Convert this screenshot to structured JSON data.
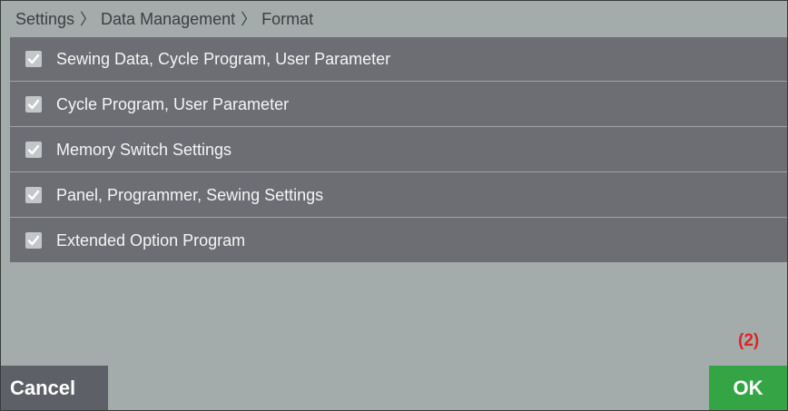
{
  "breadcrumb": {
    "items": [
      "Settings",
      "Data Management",
      "Format"
    ],
    "separator": "〉"
  },
  "format_options": [
    {
      "label": "Sewing Data, Cycle Program, User Parameter",
      "checked": true
    },
    {
      "label": "Cycle Program, User Parameter",
      "checked": true
    },
    {
      "label": "Memory Switch Settings",
      "checked": true
    },
    {
      "label": "Panel, Programmer, Sewing Settings",
      "checked": true
    },
    {
      "label": "Extended Option Program",
      "checked": true
    }
  ],
  "annotation": "(2)",
  "footer": {
    "cancel_label": "Cancel",
    "ok_label": "OK"
  },
  "colors": {
    "background": "#a4acab",
    "list_row": "#6c6e74",
    "cancel_button": "#5d6067",
    "ok_button": "#35a445",
    "annotation": "#e22323"
  },
  "icons": {
    "checkbox": "checkmark-icon"
  }
}
